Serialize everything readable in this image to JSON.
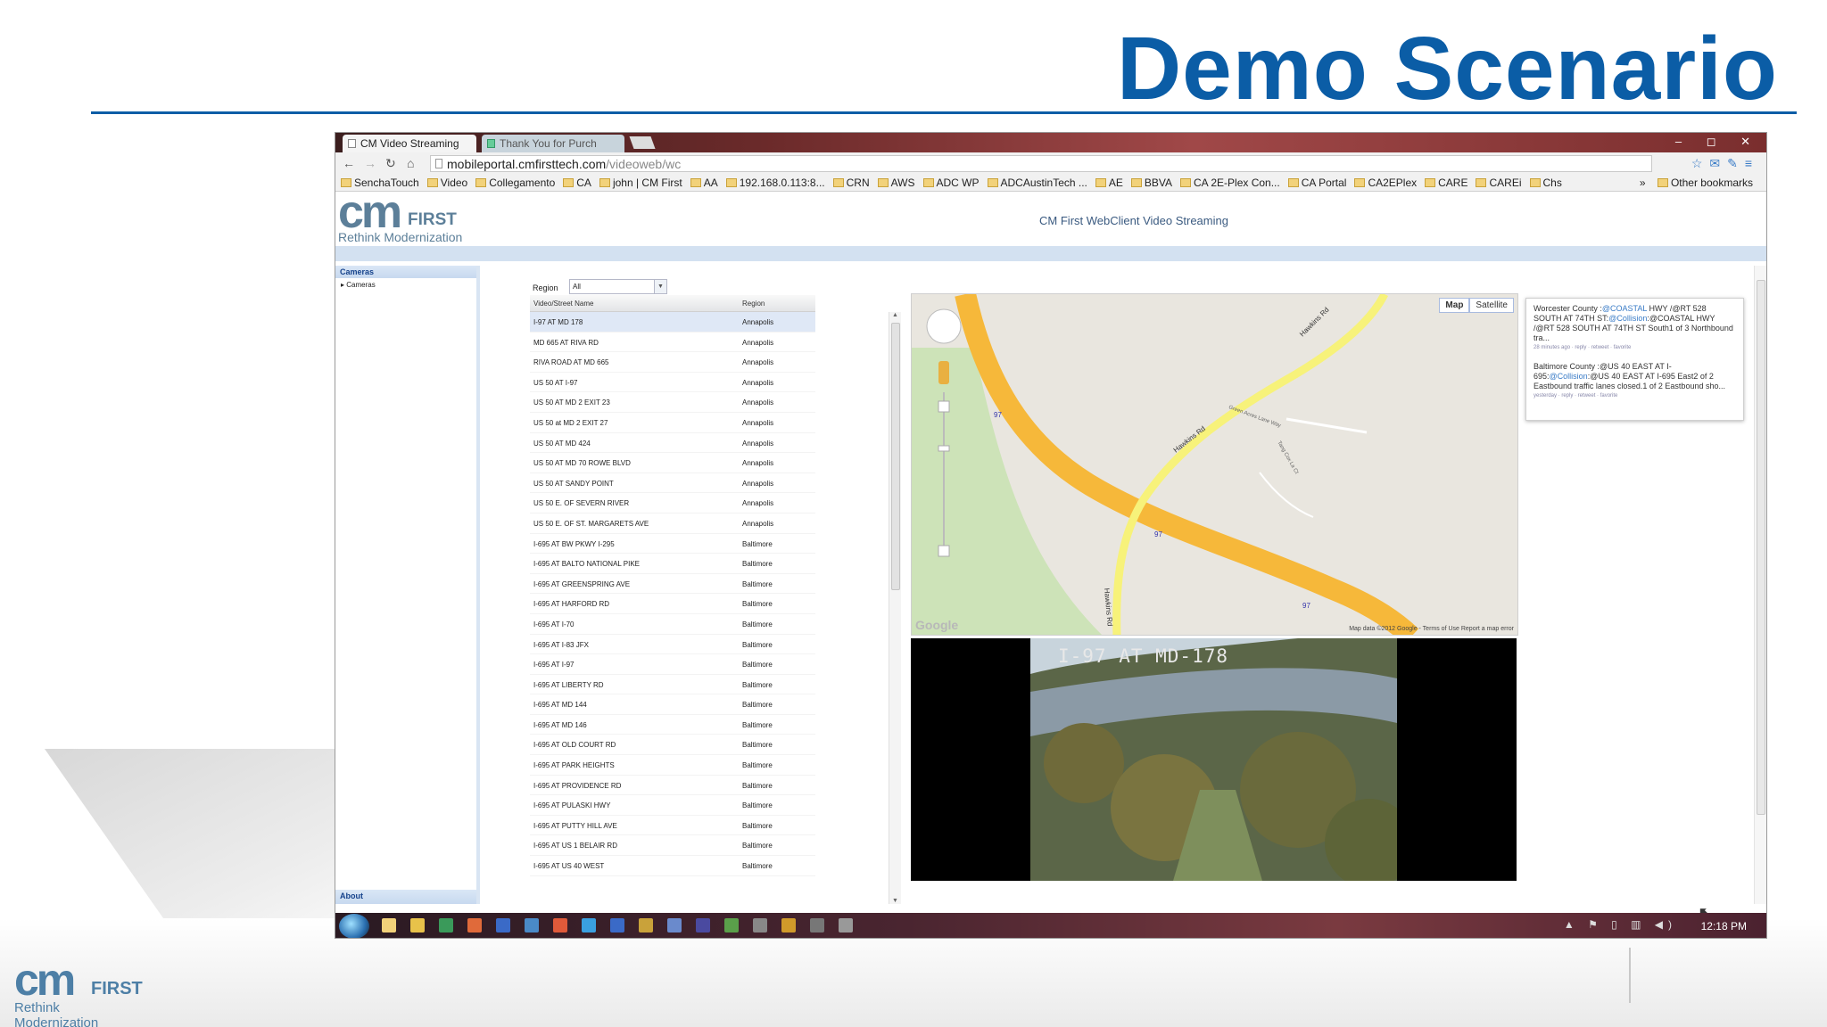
{
  "slide": {
    "title": "Demo Scenario",
    "footer_logo": {
      "cm": "cm",
      "first": "FIRST",
      "tagline": "Rethink Modernization"
    }
  },
  "browser": {
    "tabs": [
      {
        "label": "CM Video Streaming",
        "active": true
      },
      {
        "label": "Thank You for Purch",
        "active": false
      }
    ],
    "window_controls": "– ◻ ✕",
    "url_host": "mobileportal.cmfirsttech.com",
    "url_path": "/videoweb/wc",
    "bookmarks": [
      "SenchaTouch",
      "Video",
      "Collegamento",
      "CA",
      "john | CM First",
      "AA",
      "192.168.0.113:8...",
      "CRN",
      "AWS",
      "ADC WP",
      "ADCAustinTech ...",
      "AE",
      "BBVA",
      "CA 2E-Plex Con...",
      "CA Portal",
      "CA2EPlex",
      "CARE",
      "CAREi",
      "Chs"
    ],
    "bookmarks_overflow": "»",
    "other_bookmarks": "Other bookmarks"
  },
  "app": {
    "logo": {
      "cm": "cm",
      "first": "FIRST",
      "tagline": "Rethink Modernization"
    },
    "title": "CM First WebClient Video Streaming",
    "left_panel": {
      "header": "Cameras",
      "tree_item": "Cameras",
      "footer": "About"
    },
    "region": {
      "label": "Region",
      "value": "All"
    },
    "grid": {
      "columns": [
        "Video/Street Name",
        "Region"
      ],
      "rows": [
        [
          "I-97 AT MD 178",
          "Annapolis"
        ],
        [
          "MD 665 AT RIVA RD",
          "Annapolis"
        ],
        [
          "RIVA ROAD AT MD 665",
          "Annapolis"
        ],
        [
          "US 50 AT I-97",
          "Annapolis"
        ],
        [
          "US 50 AT MD 2 EXIT 23",
          "Annapolis"
        ],
        [
          "US 50 at MD 2 EXIT 27",
          "Annapolis"
        ],
        [
          "US 50 AT MD 424",
          "Annapolis"
        ],
        [
          "US 50 AT MD 70 ROWE BLVD",
          "Annapolis"
        ],
        [
          "US 50 AT SANDY POINT",
          "Annapolis"
        ],
        [
          "US 50 E. OF SEVERN RIVER",
          "Annapolis"
        ],
        [
          "US 50 E. OF ST. MARGARETS AVE",
          "Annapolis"
        ],
        [
          "I-695 AT BW PKWY I-295",
          "Baltimore"
        ],
        [
          "I-695 AT BALTO NATIONAL PIKE",
          "Baltimore"
        ],
        [
          "I-695 AT GREENSPRING AVE",
          "Baltimore"
        ],
        [
          "I-695 AT HARFORD RD",
          "Baltimore"
        ],
        [
          "I-695 AT I-70",
          "Baltimore"
        ],
        [
          "I-695 AT I-83 JFX",
          "Baltimore"
        ],
        [
          "I-695 AT I-97",
          "Baltimore"
        ],
        [
          "I-695 AT LIBERTY RD",
          "Baltimore"
        ],
        [
          "I-695 AT MD 144",
          "Baltimore"
        ],
        [
          "I-695 AT MD 146",
          "Baltimore"
        ],
        [
          "I-695 AT OLD COURT RD",
          "Baltimore"
        ],
        [
          "I-695 AT PARK HEIGHTS",
          "Baltimore"
        ],
        [
          "I-695 AT PROVIDENCE RD",
          "Baltimore"
        ],
        [
          "I-695 AT PULASKI HWY",
          "Baltimore"
        ],
        [
          "I-695 AT PUTTY HILL AVE",
          "Baltimore"
        ],
        [
          "I-695 AT US 1 BELAIR RD",
          "Baltimore"
        ],
        [
          "I-695 AT US 40 WEST",
          "Baltimore"
        ]
      ],
      "selected_index": 0
    },
    "map": {
      "buttons": [
        "Map",
        "Satellite"
      ],
      "active_button": "Map",
      "road_labels": [
        "Hawkins Rd",
        "Hawkins Rd",
        "Hawkins Rd",
        "Green Acres Lane Way",
        "Tang Cox La Ct"
      ],
      "shields": [
        "97",
        "97",
        "97"
      ],
      "attribution": "Map data ©2012 Google - Terms of Use Report a map error",
      "watermark": "Google",
      "colors": {
        "background": "#e9e6df",
        "park": "#cde3b8",
        "highway": "#f6b83a",
        "road": "#f7f27a"
      }
    },
    "video": {
      "caption": "I-97 AT MD-178"
    },
    "tweets": [
      {
        "text_a": "Worcester County :",
        "hl_a": "@COASTAL",
        "text_b": " HWY /@RT 528 SOUTH AT 74TH ST:",
        "hl_b": "@Collision",
        "text_c": ":@COASTAL HWY /@RT 528 SOUTH AT 74TH ST South1 of 3 Northbound tra...",
        "meta": "28 minutes ago · reply · retweet · favorite"
      },
      {
        "text_a": "Baltimore County :",
        "hl_a": "",
        "text_b": "@US 40 EAST AT I-695:",
        "hl_b": "@Collision",
        "text_c": ":@US 40 EAST AT I-695 East2 of 2 Eastbound traffic lanes closed.1 of 2 Eastbound sho...",
        "meta": "yesterday · reply · retweet · favorite"
      }
    ]
  },
  "taskbar": {
    "clock": "12:18 PM",
    "tray": "▲ ⚑ ▯ ▥ ◀)"
  }
}
